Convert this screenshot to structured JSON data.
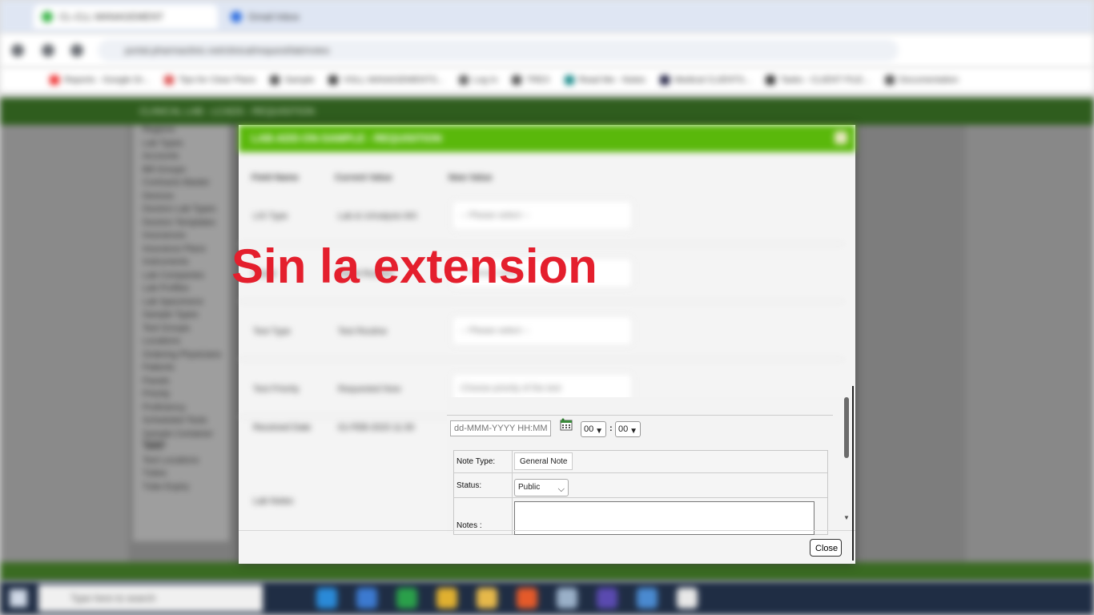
{
  "browser": {
    "tabs": [
      {
        "label": "CL-CLL MANAGEMENT"
      },
      {
        "label": "Gmail Inbox"
      }
    ],
    "url": "portal.pharmaclinic.net/clinical/request/lab/notes",
    "bookmarks": [
      "Reports - Google Dr...",
      "Tips for Clear Plans",
      "Sample",
      "VGLL MANAGEMENTS...",
      "Log In",
      "TREX",
      "Read Me - Notes",
      "Medical CLIENTS...",
      "Tasks - CLIENT FILE...",
      "Documentation"
    ]
  },
  "app": {
    "header_title": "CLINICAL LAB - LCADS - REQUISITION",
    "menu_items": [
      "Regions",
      "Lab Types",
      "Accounts",
      "Bill Groups",
      "Contracts Master",
      "Devices",
      "Doctors Lab Types",
      "Doctors Templates",
      "Insurances",
      "Insurance Plans",
      "Instruments",
      "Lab Companies",
      "Lab Profiles",
      "Lab Specimens",
      "Sample Types",
      "Test Groups",
      "Locations",
      "Ordering Physicians",
      "Patients",
      "Panels",
      "Priority",
      "Proficiency",
      "Scheduled Tests",
      "Sample Container Types",
      "Tests",
      "Test Locations",
      "Tubes",
      "Tube Expiry"
    ]
  },
  "modal": {
    "title": "LAB-ADD-ON-SAMPLE - REQUISITION",
    "columns": [
      "Field Name",
      "Current Value",
      "New Value"
    ],
    "rows": [
      {
        "field": "LIS Type",
        "current": "Lab & Urinalysis MX",
        "select": "-- Please select --"
      },
      {
        "field": "Panel",
        "current": "Panel Routine",
        "select": "-- Please select --"
      },
      {
        "field": "Test Type",
        "current": "Test Routine",
        "select": "-- Please select --"
      },
      {
        "field": "Test Priority",
        "current": "Requested Now",
        "select": "Choose priority of the test"
      },
      {
        "field": "Received Date",
        "current": "01-FEB-2023 11:30"
      },
      {
        "field": "Lab Notes",
        "current": ""
      }
    ],
    "date_placeholder": "dd-MMM-YYYY HH:MM",
    "hour": "00",
    "minute": "00",
    "note_type_label": "Note Type:",
    "note_type_value": "General Note",
    "status_label": "Status:",
    "status_value": "Public",
    "notes_label": "Notes :",
    "close_label": "Close"
  },
  "overlay_caption": "Sin la extension",
  "taskbar": {
    "search_placeholder": "Type here to search"
  },
  "colors": {
    "modal_header": "#5ab80b",
    "caption": "#e41f2d",
    "app_header": "#2f5d1e"
  }
}
